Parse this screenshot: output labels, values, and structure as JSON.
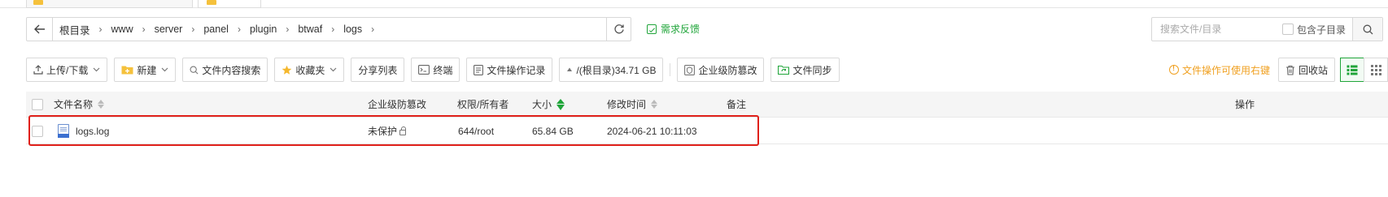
{
  "breadcrumb": {
    "items": [
      "根目录",
      "www",
      "server",
      "panel",
      "plugin",
      "btwaf",
      "logs"
    ]
  },
  "feedback_label": "需求反馈",
  "search": {
    "placeholder": "搜索文件/目录",
    "include_subdir_label": "包含子目录"
  },
  "toolbar": {
    "upload_download": "上传/下载",
    "new": "新建",
    "content_search": "文件内容搜索",
    "favorites": "收藏夹",
    "share_list": "分享列表",
    "terminal": "终端",
    "operation_log": "文件操作记录",
    "disk_usage": "/(根目录)34.71 GB",
    "tamper_protect": "企业级防篡改",
    "file_sync": "文件同步",
    "tip": "文件操作可使用右键",
    "recycle_bin": "回收站"
  },
  "table": {
    "headers": {
      "name": "文件名称",
      "tamper": "企业级防篡改",
      "perm_owner": "权限/所有者",
      "size": "大小",
      "mtime": "修改时间",
      "remark": "备注",
      "actions": "操作"
    },
    "rows": [
      {
        "name": "logs.log",
        "tamper": "未保护",
        "perm_owner": "644/root",
        "size": "65.84 GB",
        "mtime": "2024-06-21 10:11:03",
        "remark": ""
      }
    ]
  },
  "colors": {
    "accent": "#20a53a",
    "warning": "#f0a020",
    "highlight": "#e0201a"
  }
}
